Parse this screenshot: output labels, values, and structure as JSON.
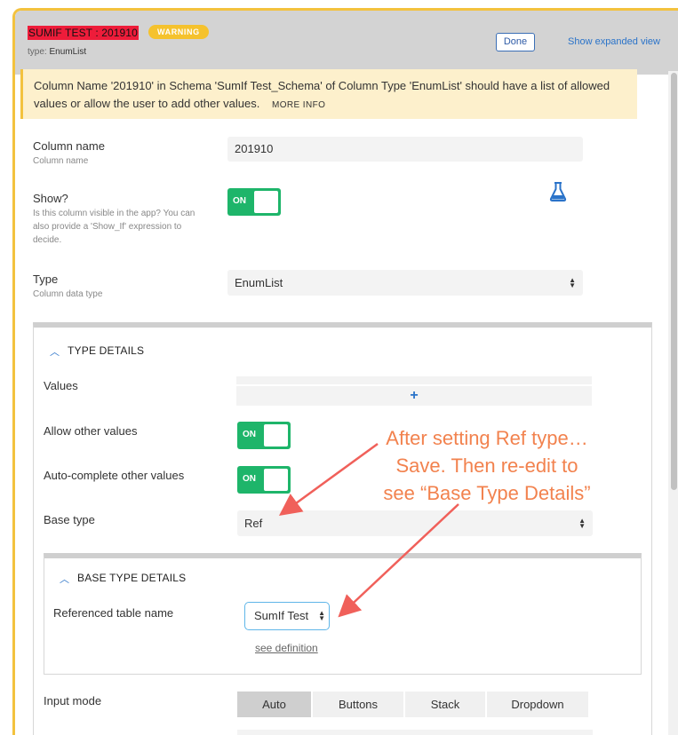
{
  "header": {
    "title": "SUMIF TEST : 201910",
    "badge": "WARNING",
    "type_prefix": "type:",
    "type_value": "EnumList",
    "done_label": "Done",
    "expand_label": "Show expanded view"
  },
  "alert": {
    "message": "Column Name '201910' in Schema 'SumIf Test_Schema' of Column Type 'EnumList' should have a list of allowed values or allow the user to add other values.",
    "more_info": "MORE INFO"
  },
  "column_name": {
    "label": "Column name",
    "sub": "Column name",
    "value": "201910"
  },
  "show": {
    "label": "Show?",
    "sub": "Is this column visible in the app? You can also provide a 'Show_If' expression to decide.",
    "toggle": "ON"
  },
  "type": {
    "label": "Type",
    "sub": "Column data type",
    "value": "EnumList"
  },
  "type_details": {
    "title": "TYPE DETAILS",
    "values_label": "Values",
    "add_symbol": "+",
    "allow_other_label": "Allow other values",
    "allow_other_toggle": "ON",
    "autocomplete_label": "Auto-complete other values",
    "autocomplete_toggle": "ON",
    "base_type_label": "Base type",
    "base_type_value": "Ref"
  },
  "base_type_details": {
    "title": "BASE TYPE DETAILS",
    "ref_table_label": "Referenced table name",
    "ref_table_value": "SumIf Test",
    "see_definition": "see definition"
  },
  "input_mode": {
    "label": "Input mode",
    "options": [
      "Auto",
      "Buttons",
      "Stack",
      "Dropdown"
    ],
    "selected": "Auto"
  },
  "annotation": {
    "line1": "After setting Ref type…",
    "line2": "Save.  Then re-edit to",
    "line3": "see “Base Type Details”"
  },
  "colors": {
    "accent_border": "#f3c23e",
    "toggle_on": "#1eb56a",
    "annotation": "#f2824e",
    "link": "#2a73c9"
  }
}
